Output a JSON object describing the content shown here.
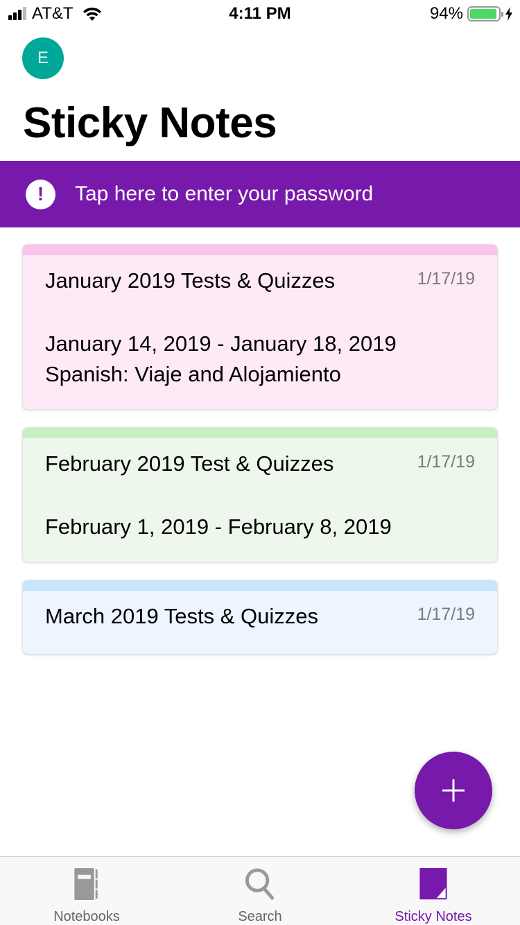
{
  "status_bar": {
    "carrier": "AT&T",
    "time": "4:11 PM",
    "battery_percent_label": "94%",
    "battery_level": 0.94,
    "signal_bars": 3,
    "signal_bars_total": 4,
    "charging": true
  },
  "header": {
    "avatar_initial": "E",
    "title": "Sticky Notes"
  },
  "banner": {
    "icon": "exclamation-icon",
    "text": "Tap here to enter your password"
  },
  "notes": [
    {
      "title": "January 2019 Tests & Quizzes",
      "date": "1/17/19",
      "lines": [
        "January 14, 2019 - January 18, 2019",
        "Spanish: Viaje and Alojamiento"
      ],
      "color": "pink"
    },
    {
      "title": "February 2019 Test & Quizzes",
      "date": "1/17/19",
      "lines": [
        "February 1, 2019 - February 8, 2019"
      ],
      "color": "green"
    },
    {
      "title": "March 2019 Tests & Quizzes",
      "date": "1/17/19",
      "lines": [],
      "color": "blue"
    }
  ],
  "fab": {
    "icon": "plus-icon",
    "label": "New sticky note"
  },
  "tab_bar": {
    "tabs": [
      {
        "label": "Notebooks",
        "icon": "notebook-icon",
        "active": false
      },
      {
        "label": "Search",
        "icon": "search-icon",
        "active": false
      },
      {
        "label": "Sticky Notes",
        "icon": "sticky-note-icon",
        "active": true
      }
    ]
  },
  "colors": {
    "accent": "#7719aa",
    "avatar": "#00a89a",
    "battery": "#4cd964",
    "inactive_icon": "#999999"
  }
}
